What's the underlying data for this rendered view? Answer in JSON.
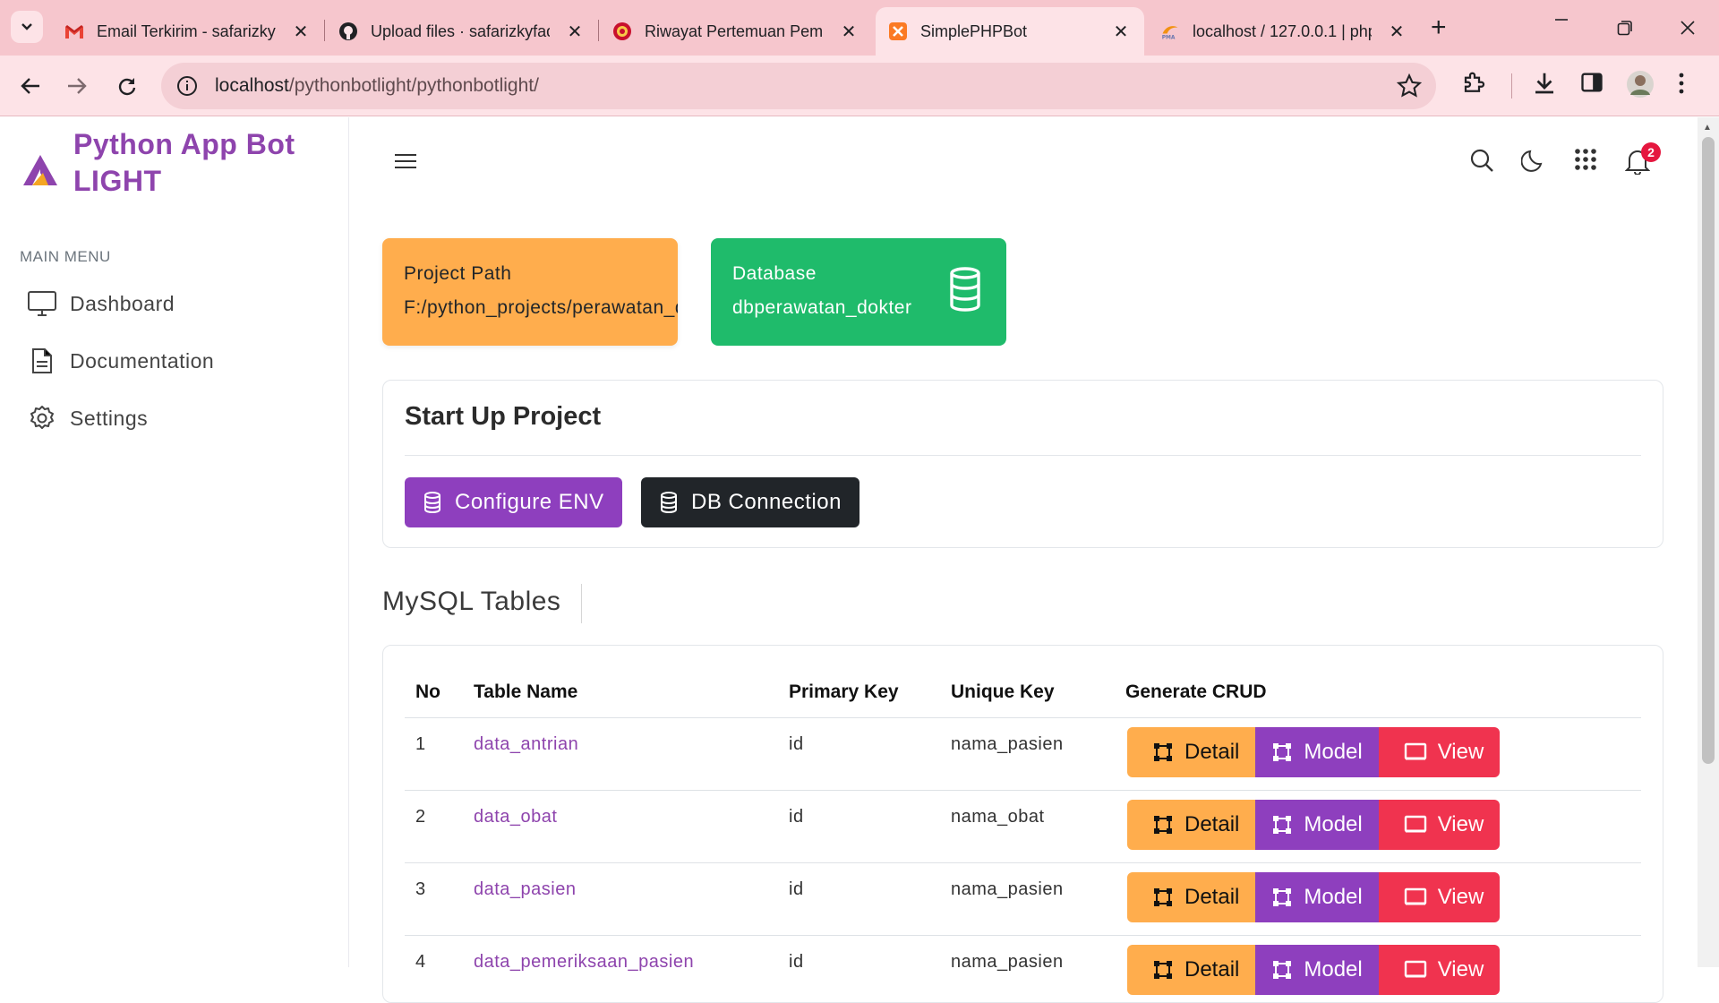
{
  "browser": {
    "tabs": [
      {
        "title": "Email Terkirim - safarizkyf",
        "icon": "gmail-icon"
      },
      {
        "title": "Upload files · safarizkyfad",
        "icon": "github-icon"
      },
      {
        "title": "Riwayat Pertemuan Pemr",
        "icon": "site-icon"
      },
      {
        "title": "SimplePHPBot",
        "icon": "xampp-icon",
        "active": true
      },
      {
        "title": "localhost / 127.0.0.1 | php",
        "icon": "phpmyadmin-icon"
      }
    ],
    "url_host": "localhost",
    "url_path": "/pythonbotlight/pythonbotlight/"
  },
  "sidebar": {
    "brand_line1": "Python App Bot",
    "brand_line2": "LIGHT",
    "menu_title": "MAIN MENU",
    "items": [
      {
        "label": "Dashboard",
        "icon": "monitor-icon"
      },
      {
        "label": "Documentation",
        "icon": "document-icon"
      },
      {
        "label": "Settings",
        "icon": "gear-icon"
      }
    ]
  },
  "header": {
    "notification_count": "2"
  },
  "cards": {
    "project_path_label": "Project Path",
    "project_path_value": "F:/python_projects/perawatan_dokter",
    "database_label": "Database",
    "database_value": "dbperawatan_dokter"
  },
  "startup": {
    "title": "Start Up Project",
    "configure_env": "Configure ENV",
    "db_connection": "DB Connection"
  },
  "tables_section": {
    "title": "MySQL Tables",
    "columns": [
      "No",
      "Table Name",
      "Primary Key",
      "Unique Key",
      "Generate CRUD"
    ],
    "rows": [
      {
        "no": "1",
        "name": "data_antrian",
        "pk": "id",
        "uk": "nama_pasien"
      },
      {
        "no": "2",
        "name": "data_obat",
        "pk": "id",
        "uk": "nama_obat"
      },
      {
        "no": "3",
        "name": "data_pasien",
        "pk": "id",
        "uk": "nama_pasien"
      },
      {
        "no": "4",
        "name": "data_pemeriksaan_pasien",
        "pk": "id",
        "uk": "nama_pasien"
      }
    ],
    "crud_labels": {
      "detail": "Detail",
      "model": "Model",
      "view": "View"
    }
  },
  "colors": {
    "accent": "#8e44ad",
    "orange": "#ffad4d",
    "green": "#1fbb6b",
    "red": "#f0334f",
    "dark": "#212529"
  }
}
